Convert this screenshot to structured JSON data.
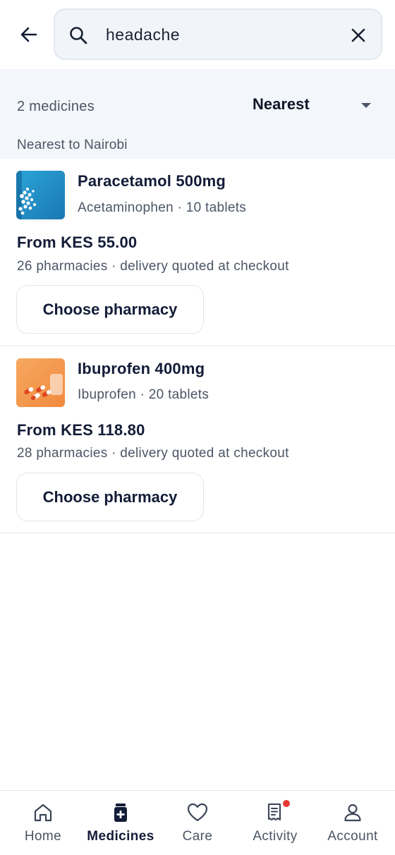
{
  "search": {
    "query": "headache"
  },
  "results_header": {
    "count_text": "2 medicines",
    "sort_label": "Nearest",
    "location_text": "Nearest to Nairobi"
  },
  "results": [
    {
      "name": "Paracetamol 500mg",
      "generic": "Acetaminophen · 10 tablets",
      "price": "From KES 55.00",
      "meta": "26 pharmacies · delivery quoted at checkout",
      "button": "Choose pharmacy"
    },
    {
      "name": "Ibuprofen 400mg",
      "generic": "Ibuprofen · 20 tablets",
      "price": "From KES 118.80",
      "meta": "28 pharmacies · delivery quoted at checkout",
      "button": "Choose pharmacy"
    }
  ],
  "nav": {
    "items": [
      {
        "label": "Home",
        "icon": "home-icon"
      },
      {
        "label": "Medicines",
        "icon": "medicine-bottle-icon",
        "active": true
      },
      {
        "label": "Care",
        "icon": "heart-icon"
      },
      {
        "label": "Activity",
        "icon": "receipt-icon",
        "badge": true
      },
      {
        "label": "Account",
        "icon": "user-icon"
      }
    ]
  },
  "colors": {
    "text_primary": "#131c37",
    "text_secondary": "#4b5565",
    "filter_bg": "#f3f6fa",
    "badge": "#e53935"
  }
}
